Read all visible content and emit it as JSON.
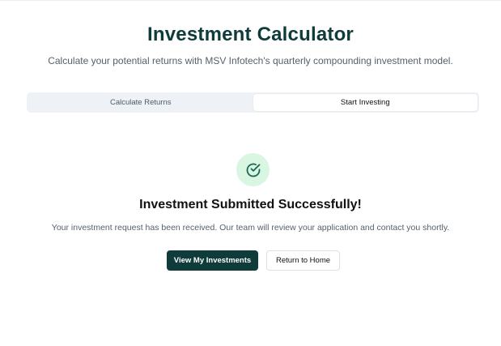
{
  "header": {
    "title": "Investment Calculator",
    "subtitle": "Calculate your potential returns with MSV Infotech's quarterly compounding investment model."
  },
  "tabs": [
    {
      "label": "Calculate Returns",
      "active": false
    },
    {
      "label": "Start Investing",
      "active": true
    }
  ],
  "success": {
    "icon": "check-circle-icon",
    "title": "Investment Submitted Successfully!",
    "message": "Your investment request has been received. Our team will review your application and contact you shortly."
  },
  "actions": {
    "primary_label": "View My Investments",
    "secondary_label": "Return to Home"
  },
  "colors": {
    "brand": "#0f3b3a",
    "success_bg": "#d9f6e2",
    "success_icon": "#1f6b57",
    "tab_bg": "#eef2f7"
  }
}
